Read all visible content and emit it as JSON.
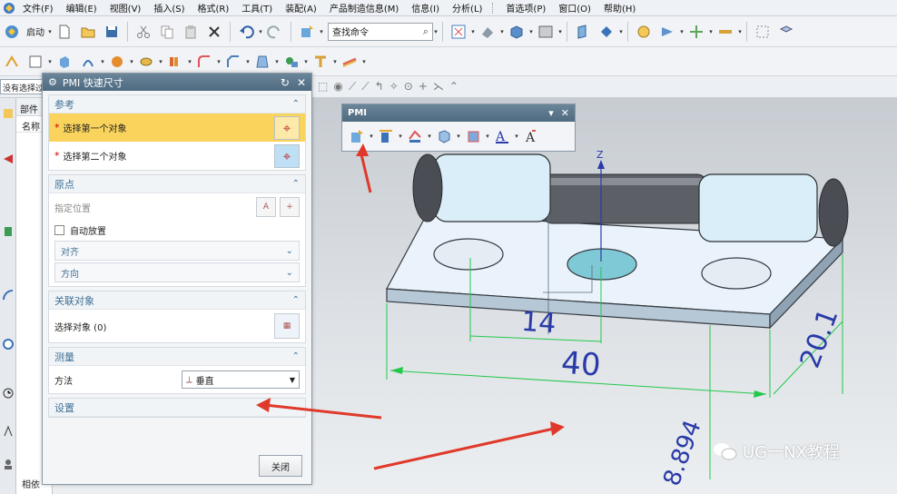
{
  "menubar": {
    "items": [
      "文件(F)",
      "编辑(E)",
      "视图(V)",
      "插入(S)",
      "格式(R)",
      "工具(T)",
      "装配(A)",
      "产品制造信息(M)",
      "信息(I)",
      "分析(L)",
      "首选项(P)",
      "窗口(O)",
      "帮助(H)"
    ]
  },
  "toolbar": {
    "start_label": "启动",
    "command_search_placeholder": "查找命令"
  },
  "selection_bar": {
    "filter_value": "没有选择过滤器"
  },
  "navigator": {
    "header": "部件",
    "column": "名称",
    "bottom_tab": "相依"
  },
  "pmi_dialog": {
    "title": "PMI 快速尺寸",
    "reference": {
      "title": "参考",
      "select_first": "选择第一个对象",
      "select_second": "选择第二个对象"
    },
    "origin": {
      "title": "原点",
      "specify_location": "指定位置",
      "auto_place": "自动放置",
      "align": "对齐",
      "direction": "方向"
    },
    "associated": {
      "title": "关联对象",
      "select_objects": "选择对象 (0)"
    },
    "measure": {
      "title": "测量",
      "method_label": "方法",
      "method_value": "垂直"
    },
    "settings": {
      "title": "设置"
    },
    "close_label": "关闭"
  },
  "pmi_toolbar": {
    "title": "PMI"
  },
  "model": {
    "axis_label": "Z",
    "dim_14": "14",
    "dim_40": "40",
    "dim_20_1": "20.1",
    "dim_8_894": "8.894"
  },
  "watermark": {
    "text": "UG一NX教程"
  },
  "colors": {
    "dialog_title": "#55708a",
    "active_row": "#f9d35c",
    "dimension_green": "#22c84a",
    "dimension_text": "#2a3aa8",
    "annotation_red": "#e0392b"
  }
}
